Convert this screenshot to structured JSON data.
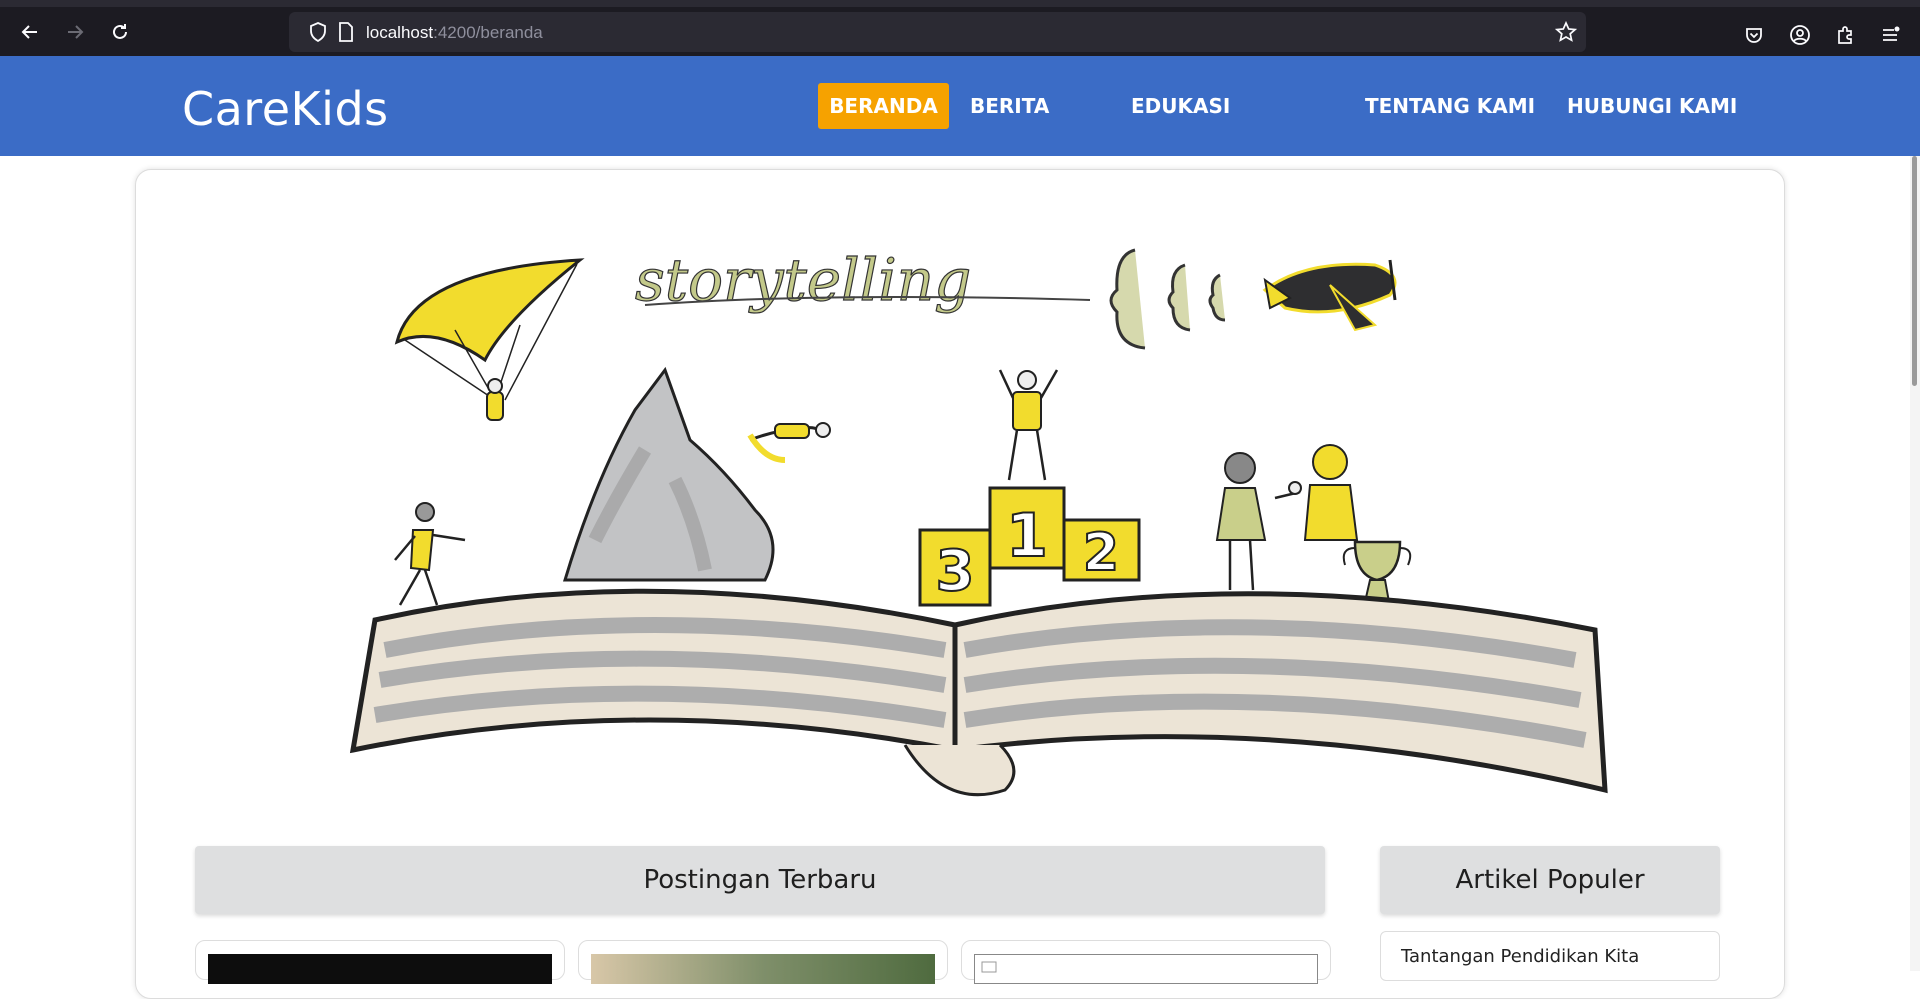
{
  "browser": {
    "url_host": "localhost",
    "url_path": ":4200/beranda"
  },
  "site": {
    "brand": "CareKids",
    "nav": [
      {
        "label": "BERANDA",
        "active": true
      },
      {
        "label": "BERITA",
        "active": false
      },
      {
        "label": "EDUKASI",
        "active": false
      },
      {
        "label": "TENTANG KAMI",
        "active": false
      },
      {
        "label": "HUBUNGI KAMI",
        "active": false
      }
    ],
    "accent_color": "#f6a200",
    "header_color": "#3b6cc6"
  },
  "hero": {
    "script_word": "storytelling",
    "podium": [
      "3",
      "1",
      "2"
    ]
  },
  "sections": {
    "latest_posts": "Postingan Terbaru",
    "popular_articles": "Artikel Populer"
  },
  "popular": {
    "items": [
      "Tantangan Pendidikan Kita"
    ]
  }
}
